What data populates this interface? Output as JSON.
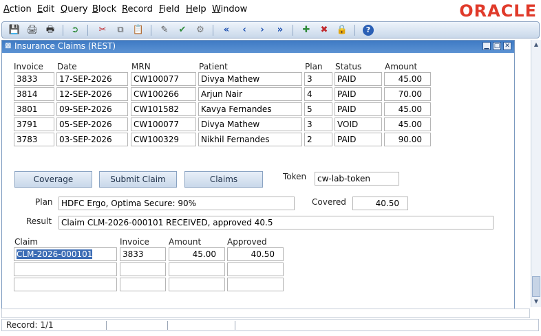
{
  "menu": {
    "items": [
      {
        "label": "Action",
        "ul": "A",
        "rest": "ction"
      },
      {
        "label": "Edit",
        "ul": "E",
        "rest": "dit"
      },
      {
        "label": "Query",
        "ul": "Q",
        "rest": "uery"
      },
      {
        "label": "Block",
        "ul": "B",
        "rest": "lock"
      },
      {
        "label": "Record",
        "ul": "R",
        "rest": "ecord"
      },
      {
        "label": "Field",
        "ul": "F",
        "rest": "ield"
      },
      {
        "label": "Help",
        "ul": "H",
        "rest": "elp"
      },
      {
        "label": "Window",
        "ul": "W",
        "rest": "indow"
      }
    ],
    "logo": "ORACLE"
  },
  "toolbar": {
    "icons": [
      "save-icon",
      "print-icon",
      "print-setup-icon",
      "exit-icon",
      "cut-icon",
      "copy-icon",
      "paste-icon",
      "clear-block-icon",
      "enter-query-icon",
      "execute-query-icon",
      "first-record-icon",
      "previous-record-icon",
      "next-record-icon",
      "last-record-icon",
      "insert-record-icon",
      "delete-record-icon",
      "lock-record-icon",
      "help-icon"
    ]
  },
  "window": {
    "title": "Insurance Claims (REST)"
  },
  "invoices": {
    "headers": {
      "invoice": "Invoice",
      "date": "Date",
      "mrn": "MRN",
      "patient": "Patient",
      "plan": "Plan",
      "status": "Status",
      "amount": "Amount"
    },
    "rows": [
      {
        "invoice": "3833",
        "date": "17-SEP-2026",
        "mrn": "CW100077",
        "patient": "Divya Mathew",
        "plan": "3",
        "status": "PAID",
        "amount": "45.00"
      },
      {
        "invoice": "3814",
        "date": "12-SEP-2026",
        "mrn": "CW100266",
        "patient": "Arjun Nair",
        "plan": "4",
        "status": "PAID",
        "amount": "70.00"
      },
      {
        "invoice": "3801",
        "date": "09-SEP-2026",
        "mrn": "CW101582",
        "patient": "Kavya Fernandes",
        "plan": "5",
        "status": "PAID",
        "amount": "45.00"
      },
      {
        "invoice": "3791",
        "date": "05-SEP-2026",
        "mrn": "CW100077",
        "patient": "Divya Mathew",
        "plan": "3",
        "status": "VOID",
        "amount": "45.00"
      },
      {
        "invoice": "3783",
        "date": "03-SEP-2026",
        "mrn": "CW100329",
        "patient": "Nikhil Fernandes",
        "plan": "2",
        "status": "PAID",
        "amount": "90.00"
      }
    ]
  },
  "actions": {
    "coverage": "Coverage",
    "submit_claim": "Submit Claim",
    "claims": "Claims",
    "token_label": "Token",
    "token_value": "cw-lab-token"
  },
  "coverage": {
    "plan_label": "Plan",
    "plan_value": "HDFC Ergo, Optima Secure: 90%",
    "covered_label": "Covered",
    "covered_value": "40.50",
    "result_label": "Result",
    "result_value": "Claim CLM-2026-000101 RECEIVED, approved 40.5"
  },
  "claims": {
    "headers": {
      "claim": "Claim",
      "invoice": "Invoice",
      "amount": "Amount",
      "approved": "Approved"
    },
    "rows": [
      {
        "claim": "CLM-2026-000101",
        "invoice": "3833",
        "amount": "45.00",
        "approved": "40.50"
      },
      {
        "claim": "",
        "invoice": "",
        "amount": "",
        "approved": ""
      },
      {
        "claim": "",
        "invoice": "",
        "amount": "",
        "approved": ""
      }
    ]
  },
  "status": {
    "record": "Record: 1/1"
  }
}
